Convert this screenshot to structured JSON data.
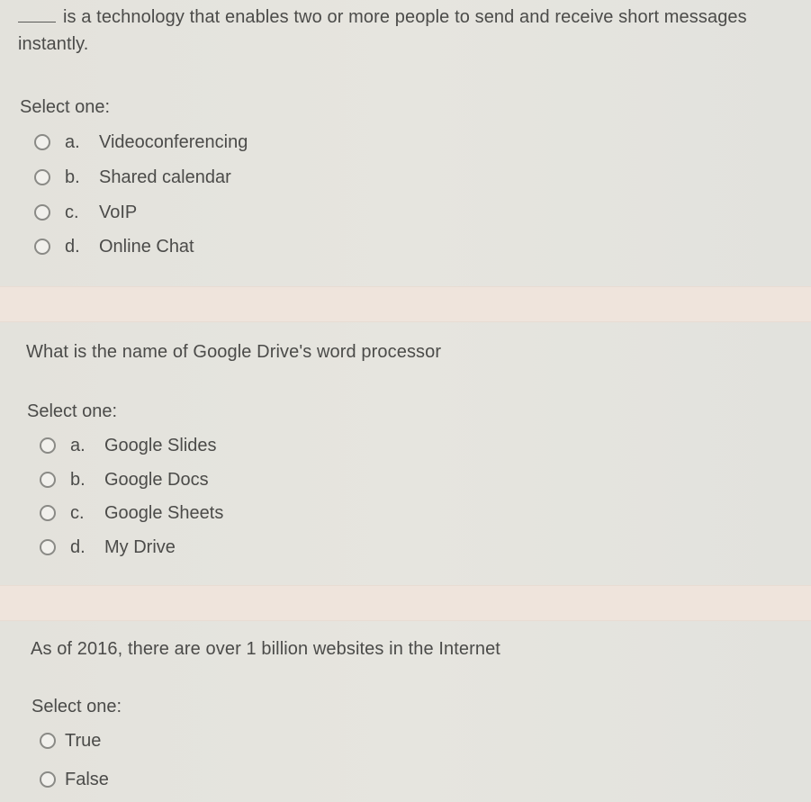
{
  "questions": [
    {
      "prompt": "is a technology that enables two or more people to send and receive short messages",
      "prompt_line2": "instantly.",
      "has_blank": true,
      "instruction": "Select one:",
      "options": [
        {
          "letter": "a.",
          "label": "Videoconferencing",
          "selected": false
        },
        {
          "letter": "b.",
          "label": "Shared calendar",
          "selected": false
        },
        {
          "letter": "c.",
          "label": "VoIP",
          "selected": false
        },
        {
          "letter": "d.",
          "label": "Online Chat",
          "selected": false
        }
      ]
    },
    {
      "prompt": "What is the name of Google Drive's word processor",
      "instruction": "Select one:",
      "options": [
        {
          "letter": "a.",
          "label": "Google Slides",
          "selected": false
        },
        {
          "letter": "b.",
          "label": "Google Docs",
          "selected": false
        },
        {
          "letter": "c.",
          "label": "Google Sheets",
          "selected": false
        },
        {
          "letter": "d.",
          "label": "My Drive",
          "selected": false
        }
      ]
    },
    {
      "prompt": "As of 2016, there are over 1 billion websites in the Internet",
      "instruction": "Select one:",
      "options": [
        {
          "label": "True",
          "selected": false
        },
        {
          "label": "False",
          "selected": false
        }
      ]
    }
  ],
  "colors": {
    "background": "#e4e3dd",
    "separator": "#efe4dc",
    "text": "#4b4b49",
    "radio_border": "#8a8a86"
  }
}
